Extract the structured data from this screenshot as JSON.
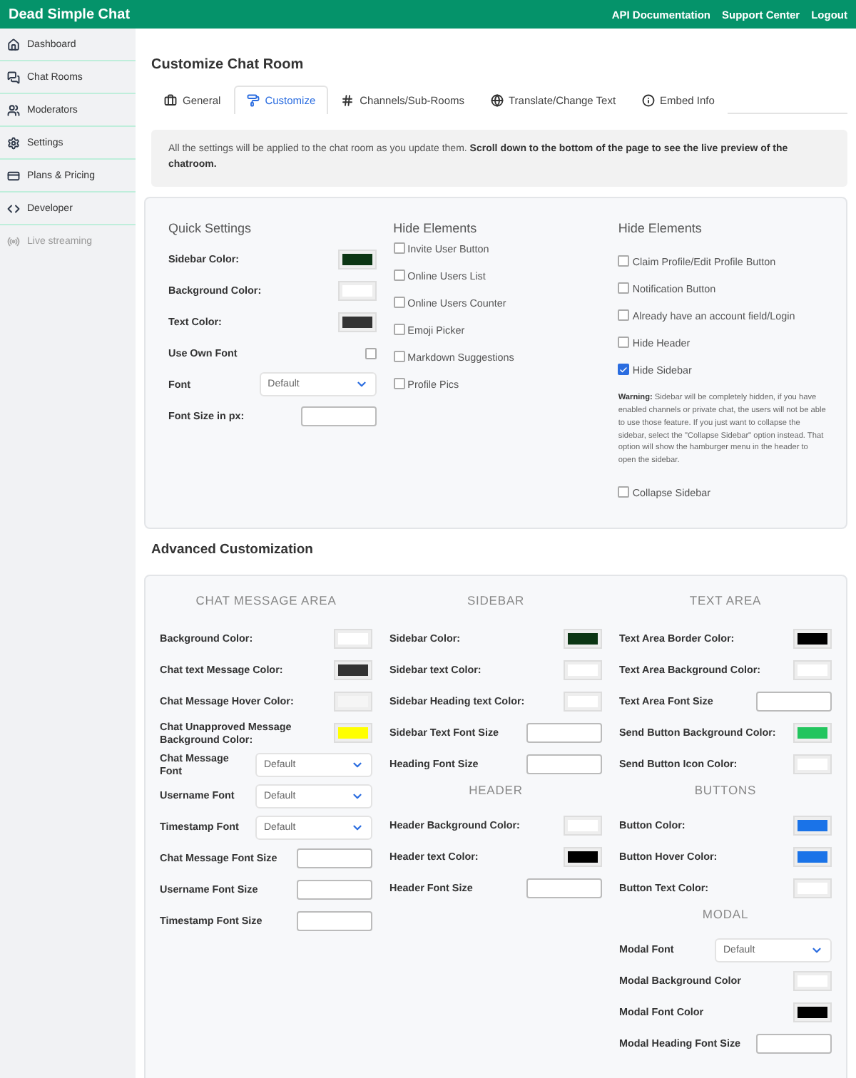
{
  "brand": "Dead Simple Chat",
  "top_links": [
    "API Documentation",
    "Support Center",
    "Logout"
  ],
  "sidebar": [
    {
      "label": "Dashboard",
      "disabled": false
    },
    {
      "label": "Chat Rooms",
      "disabled": false
    },
    {
      "label": "Moderators",
      "disabled": false
    },
    {
      "label": "Settings",
      "disabled": false
    },
    {
      "label": "Plans & Pricing",
      "disabled": false
    },
    {
      "label": "Developer",
      "disabled": false
    },
    {
      "label": "Live streaming",
      "disabled": true
    }
  ],
  "page_title": "Customize Chat Room",
  "tabs": [
    {
      "label": "General",
      "selected": false
    },
    {
      "label": "Customize",
      "selected": true
    },
    {
      "label": "Channels/Sub-Rooms",
      "selected": false
    },
    {
      "label": "Translate/Change Text",
      "selected": false
    },
    {
      "label": "Embed Info",
      "selected": false
    }
  ],
  "notice": "All the settings will be applied to the chat room as you update them. **Scroll down to the bottom of the page to see the live preview of the chatroom.**",
  "quick_settings": {
    "title": "Quick Settings",
    "fields": [
      {
        "kind": "color",
        "label": "Sidebar Color:",
        "color": "#0b3513"
      },
      {
        "kind": "color",
        "label": "Background Color:",
        "color": "#ffffff"
      },
      {
        "kind": "color",
        "label": "Text Color:",
        "color": "#333333"
      },
      {
        "kind": "checkbox",
        "label": "Use Own Font",
        "checked": false
      },
      {
        "kind": "select",
        "label": "Font",
        "value": "Default"
      },
      {
        "kind": "text",
        "label": "Font Size in px:"
      }
    ]
  },
  "hide_elements_left": {
    "title": "Hide Elements",
    "options": [
      {
        "label": "Invite User Button",
        "checked": false
      },
      {
        "label": "Online Users List",
        "checked": false
      },
      {
        "label": "Online Users Counter",
        "checked": false
      },
      {
        "label": "Emoji Picker",
        "checked": false
      },
      {
        "label": "Markdown Suggestions",
        "checked": false
      },
      {
        "label": "Profile Pics",
        "checked": false
      }
    ]
  },
  "hide_elements_right": {
    "title": "Hide Elements",
    "options": [
      {
        "label": "Claim Profile/Edit Profile Button",
        "checked": false
      },
      {
        "label": "Notification Button",
        "checked": false
      },
      {
        "label": "Already have an account field/Login",
        "checked": false
      },
      {
        "label": "Hide Header",
        "checked": false
      },
      {
        "label": "Hide Sidebar",
        "checked": true
      }
    ],
    "warning": "**Warning:** Sidebar will be completely hidden, if you have enabled channels or private chat, the users will not be able to use those feature. If you just want to collapse the sidebar, select the \"Collapse Sidebar\" option instead. That option will show the hamburger menu in the header to open the sidebar.",
    "extra_option": {
      "label": "Collapse Sidebar",
      "checked": false
    }
  },
  "advanced": {
    "title": "Advanced Customization",
    "columns": [
      {
        "sections": [
          {
            "heading": "CHAT MESSAGE AREA",
            "fields": [
              {
                "kind": "color",
                "label": "Background Color:",
                "color": "#ffffff"
              },
              {
                "kind": "color",
                "label": "Chat text Message Color:",
                "color": "#333333"
              },
              {
                "kind": "color",
                "label": "Chat Message Hover Color:",
                "color": "#f5f5f5"
              },
              {
                "kind": "color",
                "label": "Chat Unapproved Message Background Color:",
                "color": "#ffff00"
              },
              {
                "kind": "select",
                "label": "Chat Message Font",
                "value": "Default"
              },
              {
                "kind": "select",
                "label": "Username Font",
                "value": "Default"
              },
              {
                "kind": "select",
                "label": "Timestamp Font",
                "value": "Default"
              },
              {
                "kind": "text",
                "label": "Chat Message Font Size"
              },
              {
                "kind": "text",
                "label": "Username Font Size"
              },
              {
                "kind": "text",
                "label": "Timestamp Font Size"
              }
            ]
          }
        ]
      },
      {
        "sections": [
          {
            "heading": "SIDEBAR",
            "fields": [
              {
                "kind": "color",
                "label": "Sidebar Color:",
                "color": "#0b3513"
              },
              {
                "kind": "color",
                "label": "Sidebar text Color:",
                "color": "#ffffff"
              },
              {
                "kind": "color",
                "label": "Sidebar Heading text Color:",
                "color": "#ffffff"
              },
              {
                "kind": "text",
                "label": "Sidebar Text Font Size"
              },
              {
                "kind": "text",
                "label": "Heading Font Size"
              }
            ]
          },
          {
            "heading": "HEADER",
            "fields": [
              {
                "kind": "color",
                "label": "Header Background Color:",
                "color": "#ffffff"
              },
              {
                "kind": "color",
                "label": "Header text Color:",
                "color": "#000000"
              },
              {
                "kind": "text",
                "label": "Header Font Size"
              }
            ]
          }
        ]
      },
      {
        "sections": [
          {
            "heading": "TEXT AREA",
            "fields": [
              {
                "kind": "color",
                "label": "Text Area Border Color:",
                "color": "#000000"
              },
              {
                "kind": "color",
                "label": "Text Area Background Color:",
                "color": "#ffffff"
              },
              {
                "kind": "text",
                "label": "Text Area Font Size"
              },
              {
                "kind": "color",
                "label": "Send Button Background Color:",
                "color": "#22c55e"
              },
              {
                "kind": "color",
                "label": "Send Button Icon Color:",
                "color": "#ffffff"
              }
            ]
          },
          {
            "heading": "BUTTONS",
            "fields": [
              {
                "kind": "color",
                "label": "Button Color:",
                "color": "#1a73e8"
              },
              {
                "kind": "color",
                "label": "Button Hover Color:",
                "color": "#1a73e8"
              },
              {
                "kind": "color",
                "label": "Button Text Color:",
                "color": "#ffffff"
              }
            ]
          },
          {
            "heading": "MODAL",
            "fields": [
              {
                "kind": "select",
                "label": "Modal Font",
                "value": "Default"
              },
              {
                "kind": "color",
                "label": "Modal Background Color",
                "color": "#ffffff"
              },
              {
                "kind": "color",
                "label": "Modal Font Color",
                "color": "#000000"
              },
              {
                "kind": "text",
                "label": "Modal Heading Font Size"
              }
            ]
          }
        ]
      }
    ]
  }
}
